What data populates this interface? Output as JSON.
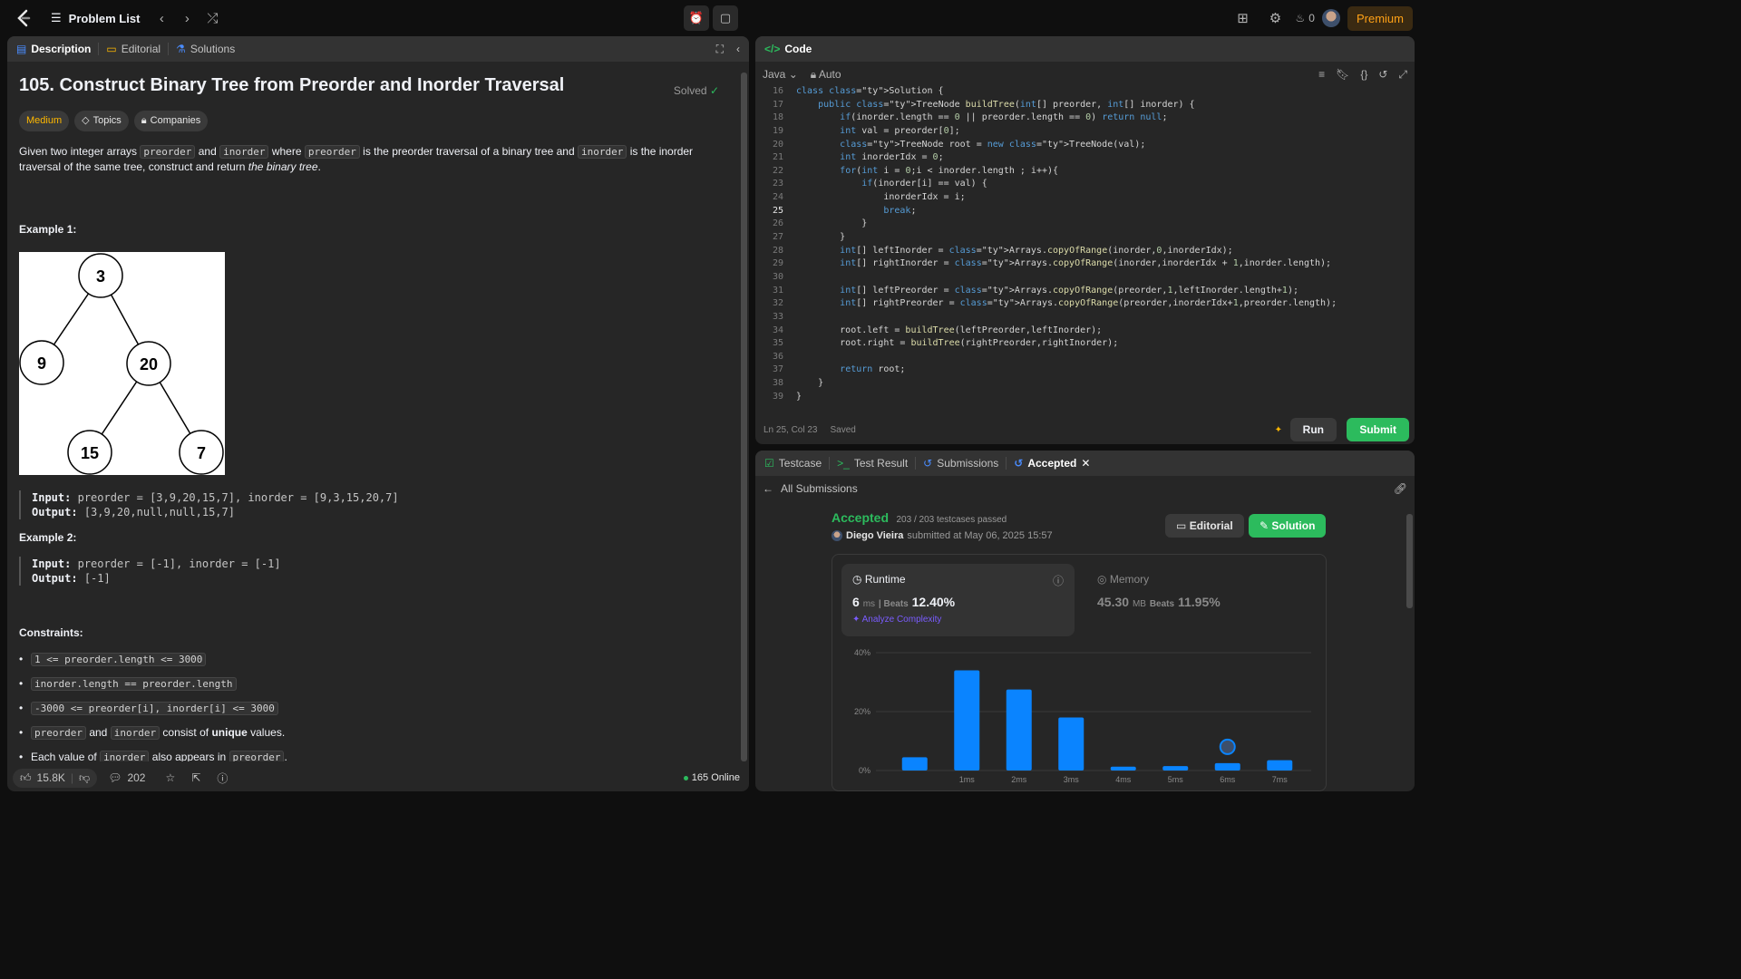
{
  "topbar": {
    "problem_list": "Problem List",
    "streak": "0",
    "premium": "Premium"
  },
  "left": {
    "tabs": [
      "Description",
      "Editorial",
      "Solutions"
    ],
    "title": "105. Construct Binary Tree from Preorder and Inorder Traversal",
    "solved": "Solved",
    "badges": {
      "difficulty": "Medium",
      "topics": "Topics",
      "companies": "Companies"
    },
    "statement": {
      "p1": "Given two integer arrays",
      "c1": "preorder",
      "p2": "and",
      "c2": "inorder",
      "p3": "where",
      "c3": "preorder",
      "p4": "is the preorder traversal of a binary tree and",
      "c4": "inorder",
      "p5": "is the inorder traversal of the same tree, construct and return",
      "em": "the binary tree",
      "p6": "."
    },
    "example1": {
      "heading": "Example 1:",
      "tree_nodes": [
        "3",
        "9",
        "20",
        "15",
        "7"
      ],
      "input_label": "Input:",
      "input": "preorder = [3,9,20,15,7], inorder = [9,3,15,20,7]",
      "output_label": "Output:",
      "output": "[3,9,20,null,null,15,7]"
    },
    "example2": {
      "heading": "Example 2:",
      "input_label": "Input:",
      "input": "preorder = [-1], inorder = [-1]",
      "output_label": "Output:",
      "output": "[-1]"
    },
    "constraints": {
      "heading": "Constraints:",
      "c1": "1 <= preorder.length <= 3000",
      "c2": "inorder.length == preorder.length",
      "c3": "-3000 <= preorder[i], inorder[i] <= 3000",
      "c4a": "preorder",
      "c4b": "and",
      "c4c": "inorder",
      "c4d": "consist of",
      "c4e": "unique",
      "c4f": "values.",
      "c5a": "Each value of",
      "c5b": "inorder",
      "c5c": "also appears in",
      "c5d": "preorder",
      "c5e": "."
    },
    "footer": {
      "likes": "15.8K",
      "comments": "202",
      "online": "165 Online"
    }
  },
  "code": {
    "title": "Code",
    "language": "Java",
    "mode": "Auto",
    "status": {
      "position": "Ln 25, Col 23",
      "saved": "Saved"
    },
    "run": "Run",
    "submit": "Submit",
    "lines": [
      {
        "n": "16",
        "t": "class Solution {"
      },
      {
        "n": "17",
        "t": "    public TreeNode buildTree(int[] preorder, int[] inorder) {"
      },
      {
        "n": "18",
        "t": "        if(inorder.length == 0 || preorder.length == 0) return null;"
      },
      {
        "n": "19",
        "t": "        int val = preorder[0];"
      },
      {
        "n": "20",
        "t": "        TreeNode root = new TreeNode(val);"
      },
      {
        "n": "21",
        "t": "        int inorderIdx = 0;"
      },
      {
        "n": "22",
        "t": "        for(int i = 0;i < inorder.length ; i++){"
      },
      {
        "n": "23",
        "t": "            if(inorder[i] == val) {"
      },
      {
        "n": "24",
        "t": "                inorderIdx = i;"
      },
      {
        "n": "25",
        "t": "                break;"
      },
      {
        "n": "26",
        "t": "            }"
      },
      {
        "n": "27",
        "t": "        }"
      },
      {
        "n": "28",
        "t": "        int[] leftInorder = Arrays.copyOfRange(inorder,0,inorderIdx);"
      },
      {
        "n": "29",
        "t": "        int[] rightInorder = Arrays.copyOfRange(inorder,inorderIdx + 1,inorder.length);"
      },
      {
        "n": "30",
        "t": ""
      },
      {
        "n": "31",
        "t": "        int[] leftPreorder = Arrays.copyOfRange(preorder,1,leftInorder.length+1);"
      },
      {
        "n": "32",
        "t": "        int[] rightPreorder = Arrays.copyOfRange(preorder,inorderIdx+1,preorder.length);"
      },
      {
        "n": "33",
        "t": ""
      },
      {
        "n": "34",
        "t": "        root.left = buildTree(leftPreorder,leftInorder);"
      },
      {
        "n": "35",
        "t": "        root.right = buildTree(rightPreorder,rightInorder);"
      },
      {
        "n": "36",
        "t": ""
      },
      {
        "n": "37",
        "t": "        return root;"
      },
      {
        "n": "38",
        "t": "    }"
      },
      {
        "n": "39",
        "t": "}"
      }
    ]
  },
  "result": {
    "tabs": [
      "Testcase",
      "Test Result",
      "Submissions",
      "Accepted"
    ],
    "all_submissions": "All Submissions",
    "status": "Accepted",
    "testcases": "203 / 203 testcases passed",
    "user": "Diego Vieira",
    "submitted": "submitted at May 06, 2025 15:57",
    "editorial_btn": "Editorial",
    "solution_btn": "Solution",
    "runtime": {
      "label": "Runtime",
      "value": "6",
      "unit": "ms",
      "beats_label": "Beats",
      "beats": "12.40%",
      "analyze": "Analyze Complexity"
    },
    "memory": {
      "label": "Memory",
      "value": "45.30",
      "unit": "MB",
      "beats_label": "Beats",
      "beats": "11.95%"
    }
  },
  "chart_data": {
    "type": "bar",
    "categories": [
      "",
      "1ms",
      "2ms",
      "3ms",
      "4ms",
      "5ms",
      "6ms",
      "7ms"
    ],
    "values": [
      4.5,
      34,
      27.5,
      18,
      1.3,
      1.5,
      2.5,
      3.5
    ],
    "highlighted_category": "6ms",
    "y_ticks": [
      "0%",
      "20%",
      "40%"
    ],
    "ylim": [
      0,
      40
    ],
    "bar_color": "#0a84ff"
  }
}
